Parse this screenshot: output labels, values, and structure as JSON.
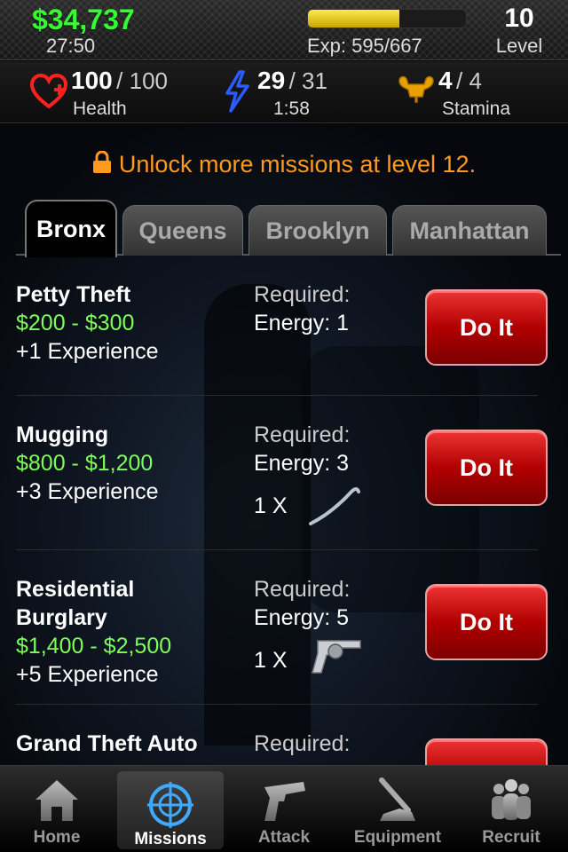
{
  "header": {
    "cash": "$34,737",
    "cash_timer": "27:50",
    "experience_text": "Exp: 595/667",
    "experience_progress": 0.58,
    "level_value": "10",
    "level_label": "Level"
  },
  "stats": {
    "health": {
      "value": "100",
      "max": "/ 100",
      "label": "Health",
      "icon": "heart-icon",
      "color": "#ff2222"
    },
    "energy": {
      "value": "29",
      "max": "/ 31",
      "label": "1:58",
      "icon": "lightning-bolt-icon",
      "color": "#2a5cff"
    },
    "stamina": {
      "value": "4",
      "max": "/ 4",
      "label": "Stamina",
      "icon": "flexed-arm-icon",
      "color": "#e8a000"
    }
  },
  "unlock_message": "Unlock more missions at level 12.",
  "tabs": [
    {
      "label": "Bronx",
      "active": true
    },
    {
      "label": "Queens",
      "active": false
    },
    {
      "label": "Brooklyn",
      "active": false
    },
    {
      "label": "Manhattan",
      "active": false
    }
  ],
  "missions": [
    {
      "title": "Petty Theft",
      "payout": "$200 - $300",
      "experience": "+1 Experience",
      "required_label": "Required:",
      "energy": "Energy: 1",
      "item_qty": "",
      "button": "Do It"
    },
    {
      "title": "Mugging",
      "payout": "$800 - $1,200",
      "experience": "+3 Experience",
      "required_label": "Required:",
      "energy": "Energy: 3",
      "item_qty": "1 X",
      "item_icon": "crowbar-icon",
      "button": "Do It"
    },
    {
      "title_line1": "Residential",
      "title_line2": "Burglary",
      "payout": "$1,400 - $2,500",
      "experience": "+5 Experience",
      "required_label": "Required:",
      "energy": "Energy: 5",
      "item_qty": "1 X",
      "item_icon": "revolver-icon",
      "button": "Do It"
    },
    {
      "title": "Grand Theft Auto",
      "required_label": "Required:"
    }
  ],
  "bottom_nav": [
    {
      "label": "Home",
      "icon": "house-icon",
      "active": false
    },
    {
      "label": "Missions",
      "icon": "crosshair-icon",
      "active": true
    },
    {
      "label": "Attack",
      "icon": "pistol-icon",
      "active": false
    },
    {
      "label": "Equipment",
      "icon": "weapon-launcher-icon",
      "active": false
    },
    {
      "label": "Recruit",
      "icon": "people-group-icon",
      "active": false
    }
  ]
}
